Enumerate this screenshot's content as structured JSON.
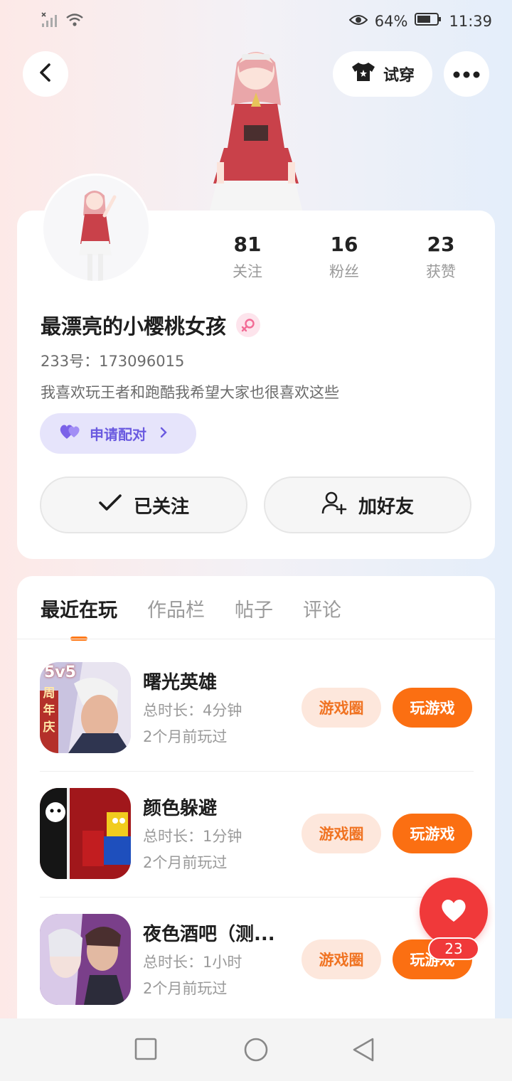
{
  "status_bar": {
    "battery": "64%",
    "time": "11:39"
  },
  "header": {
    "try_on_label": "试穿"
  },
  "profile": {
    "stats": [
      {
        "value": "81",
        "label": "关注"
      },
      {
        "value": "16",
        "label": "粉丝"
      },
      {
        "value": "23",
        "label": "获赞"
      }
    ],
    "nickname": "最漂亮的小樱桃女孩",
    "uid": "233号：173096015",
    "bio": "我喜欢玩王者和跑酷我希望大家也很喜欢这些",
    "pair_label": "申请配对",
    "followed_label": "已关注",
    "add_friend_label": "加好友"
  },
  "tabs": [
    "最近在玩",
    "作品栏",
    "帖子",
    "评论"
  ],
  "games": [
    {
      "name": "曙光英雄",
      "duration": "总时长：4分钟",
      "last_played": "2个月前玩过",
      "circle_label": "游戏圈",
      "play_label": "玩游戏"
    },
    {
      "name": "颜色躲避",
      "duration": "总时长：1分钟",
      "last_played": "2个月前玩过",
      "circle_label": "游戏圈",
      "play_label": "玩游戏"
    },
    {
      "name": "夜色酒吧（测...",
      "duration": "总时长：1小时",
      "last_played": "2个月前玩过",
      "circle_label": "游戏圈",
      "play_label": "玩游戏"
    }
  ],
  "game_icon_text": {
    "badge_5v5": "5v5",
    "anniversary": "周年庆"
  },
  "like_fab": {
    "count": "23"
  },
  "colors": {
    "accent": "#fb6f12",
    "like": "#f0393a",
    "pair": "#6a5ae0"
  }
}
